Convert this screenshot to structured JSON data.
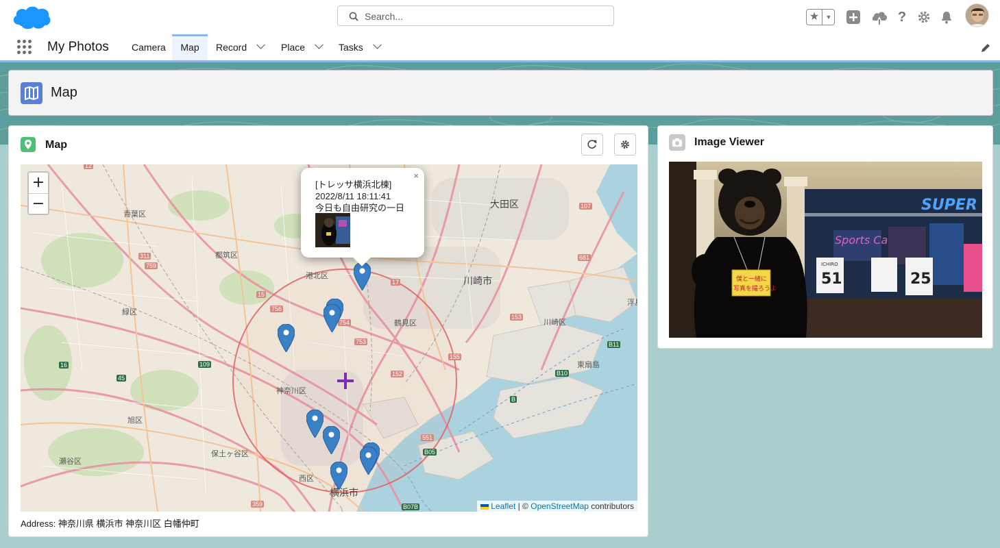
{
  "header": {
    "search_placeholder": "Search..."
  },
  "nav": {
    "app_name": "My Photos",
    "tabs": [
      {
        "label": "Camera",
        "dropdown": false,
        "active": false
      },
      {
        "label": "Map",
        "dropdown": false,
        "active": true
      },
      {
        "label": "Record",
        "dropdown": true,
        "active": false
      },
      {
        "label": "Place",
        "dropdown": true,
        "active": false
      },
      {
        "label": "Tasks",
        "dropdown": true,
        "active": false
      }
    ]
  },
  "page_header": {
    "title": "Map"
  },
  "map_card": {
    "title": "Map",
    "zoom_in": "+",
    "zoom_out": "−",
    "popup": {
      "place": "[トレッサ横浜北棟]",
      "datetime": "2022/8/11 18:11:41",
      "caption": "今日も自由研究の一日",
      "close": "×"
    },
    "attribution": {
      "leaflet": "Leaflet",
      "sep": " | © ",
      "osm": "OpenStreetMap",
      "suffix": " contributors"
    },
    "labels": {
      "ota": "大田区",
      "kawasaki_city": "川崎市",
      "kawasaki_ward": "川崎区",
      "aoba": "青葉区",
      "tsuzuki": "都筑区",
      "midori": "緑区",
      "kohoku": "港北区",
      "tsurumi": "鶴見区",
      "kanagawa": "神奈川区",
      "asahi": "旭区",
      "hodogaya": "保土ヶ谷区",
      "seya": "瀬谷区",
      "nishi": "西区",
      "yokohama": "横浜市",
      "higashiogishima": "東扇島",
      "ukishima": "浮島"
    },
    "route_shields": [
      "12",
      "107",
      "681",
      "153",
      "759",
      "756",
      "754",
      "753",
      "152",
      "155",
      "551",
      "16",
      "45",
      "109",
      "359",
      "B11",
      "B10",
      "B",
      "B07B",
      "B05",
      "17",
      "15",
      "311"
    ],
    "address": "Address: 神奈川県 横浜市 神奈川区 白幡仲町"
  },
  "image_viewer": {
    "title": "Image Viewer",
    "sign_text_1": "僕と一緒に",
    "sign_text_2": "写真を撮ろうよ",
    "jersey_1_name": "ICHIRO",
    "jersey_1_number": "51",
    "jersey_2_number": "25",
    "neon": "Sports Ca",
    "store_sign": "SUPER"
  },
  "colors": {
    "accent": "#0176d3",
    "band": "#5c9e9b",
    "background": "#a8cfcd",
    "marker": "#3a80c6",
    "radius_circle": "#e0615f",
    "center_cross": "#7a2bb3"
  }
}
